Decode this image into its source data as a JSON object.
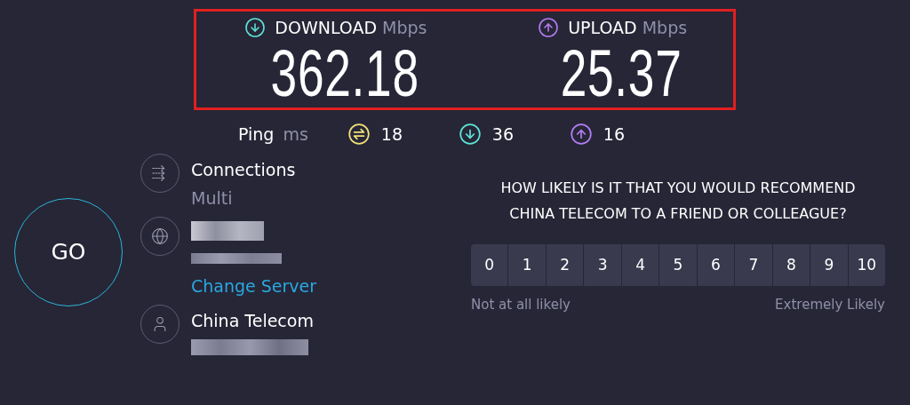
{
  "results": {
    "highlighted": true,
    "metrics": [
      {
        "kind": "download",
        "label": "DOWNLOAD",
        "unit": "Mbps",
        "value": "362.18"
      },
      {
        "kind": "upload",
        "label": "UPLOAD",
        "unit": "Mbps",
        "value": "25.37"
      }
    ]
  },
  "ping": {
    "label": "Ping",
    "unit": "ms",
    "values": [
      {
        "kind": "idle",
        "value": "18"
      },
      {
        "kind": "download",
        "value": "36"
      },
      {
        "kind": "upload",
        "value": "16"
      }
    ]
  },
  "go_button": {
    "label": "GO"
  },
  "info": [
    {
      "kind": "connections",
      "title": "Connections",
      "subtitle": "Multi"
    },
    {
      "kind": "server",
      "blurred": true,
      "link": "Change Server"
    },
    {
      "kind": "provider",
      "title": "China Telecom",
      "blurred": true
    }
  ],
  "survey": {
    "question": "HOW LIKELY IS IT THAT YOU WOULD RECOMMEND CHINA TELECOM TO A FRIEND OR COLLEAGUE?",
    "options": [
      {
        "label": "0",
        "selected": false
      },
      {
        "label": "1",
        "selected": false
      },
      {
        "label": "2",
        "selected": false
      },
      {
        "label": "3",
        "selected": false
      },
      {
        "label": "4",
        "selected": false
      },
      {
        "label": "5",
        "selected": false
      },
      {
        "label": "6",
        "selected": false
      },
      {
        "label": "7",
        "selected": false
      },
      {
        "label": "8",
        "selected": false
      },
      {
        "label": "9",
        "selected": false
      },
      {
        "label": "10",
        "selected": false
      }
    ],
    "low_label": "Not at all likely",
    "high_label": "Extremely Likely"
  }
}
